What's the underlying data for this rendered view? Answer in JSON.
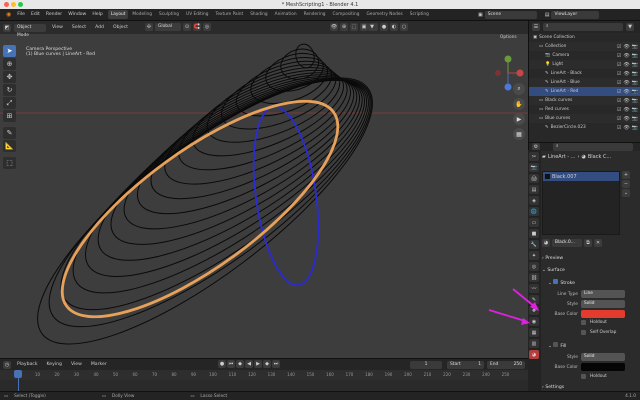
{
  "window": {
    "title": "* MeshScripting1 - Blender 4.1"
  },
  "menu": {
    "items": [
      "File",
      "Edit",
      "Render",
      "Window",
      "Help"
    ]
  },
  "workspaces": {
    "tabs": [
      "Layout",
      "Modeling",
      "Sculpting",
      "UV Editing",
      "Texture Paint",
      "Shading",
      "Animation",
      "Rendering",
      "Compositing",
      "Geometry Nodes",
      "Scripting"
    ],
    "active": "Layout"
  },
  "scene": {
    "name": "Scene",
    "view_layer": "ViewLayer"
  },
  "viewport": {
    "mode": "Object Mode",
    "menus": [
      "View",
      "Select",
      "Add",
      "Object"
    ],
    "transform": "Global",
    "options_label": "Options",
    "info_line1": "Camera Perspective",
    "info_line2": "(1) Blue curves | LineArt - Red"
  },
  "outliner": {
    "search_placeholder": "",
    "rows": [
      {
        "label": "Scene Collection",
        "indent": 0
      },
      {
        "label": "Collection",
        "indent": 1
      },
      {
        "label": "Camera",
        "indent": 2
      },
      {
        "label": "Light",
        "indent": 2
      },
      {
        "label": "LineArt - Black",
        "indent": 2
      },
      {
        "label": "LineArt - Blue",
        "indent": 2
      },
      {
        "label": "LineArt - Red",
        "indent": 2,
        "selected": true
      },
      {
        "label": "Black curves",
        "indent": 1
      },
      {
        "label": "Red curves",
        "indent": 1
      },
      {
        "label": "Blue curves",
        "indent": 1
      },
      {
        "label": "BezierCircle.023",
        "indent": 2
      }
    ]
  },
  "properties": {
    "breadcrumb_object": "LineArt - ...",
    "breadcrumb_data": "Black C...",
    "material_slot": "Black.007",
    "material_name": "Black.0...",
    "preview": "Preview",
    "surface": "Surface",
    "stroke": "Stroke",
    "line_type_label": "Line Type",
    "line_type_value": "Line",
    "style_label": "Style",
    "style_value": "Solid",
    "base_color_label": "Base Color",
    "holdout": "Holdout",
    "self_overlap": "Self Overlap",
    "fill": "Fill",
    "fill_style_label": "Style",
    "fill_style_value": "Solid",
    "fill_base_color_label": "Base Color",
    "fill_holdout": "Holdout",
    "settings": "Settings"
  },
  "timeline": {
    "menus": [
      "Playback",
      "Keying",
      "View",
      "Marker"
    ],
    "current_frame": "1",
    "start_label": "Start",
    "start_value": "1",
    "end_label": "End",
    "end_value": "250",
    "ticks": [
      "0",
      "10",
      "20",
      "30",
      "40",
      "50",
      "60",
      "70",
      "80",
      "90",
      "100",
      "110",
      "120",
      "130",
      "140",
      "150",
      "160",
      "170",
      "180",
      "190",
      "200",
      "210",
      "220",
      "230",
      "240",
      "250"
    ]
  },
  "status": {
    "select": "Select (Toggle)",
    "dolly": "Dolly View",
    "lasso": "Lasso Select",
    "version": "4.1.0"
  },
  "colors": {
    "orange": "#e8a15a",
    "blue": "#2b2bd6",
    "red": "#e33b2e",
    "magenta": "#e020e0",
    "selected": "#334d80"
  }
}
